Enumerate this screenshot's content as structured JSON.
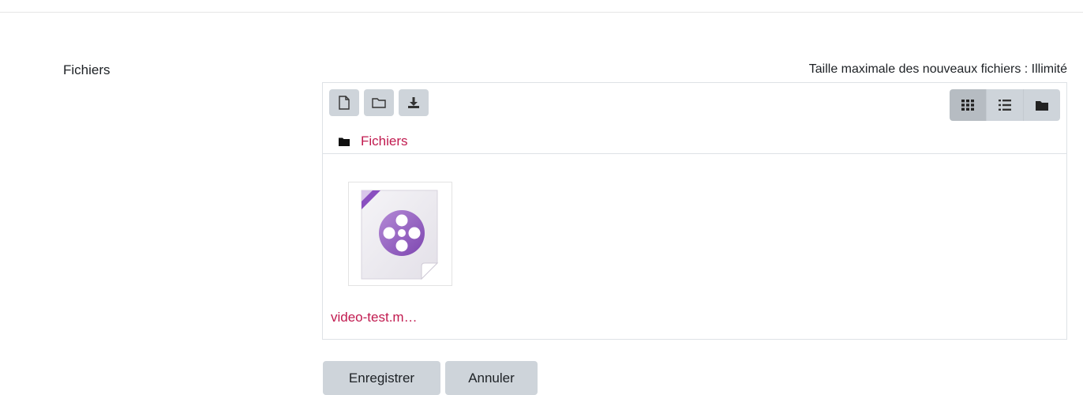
{
  "form": {
    "field_label": "Fichiers",
    "max_size_text": "Taille maximale des nouveaux fichiers : Illimité"
  },
  "filemanager": {
    "toolbar": [
      {
        "icon": "new-file-icon"
      },
      {
        "icon": "new-folder-icon"
      },
      {
        "icon": "download-icon"
      }
    ],
    "view_modes": [
      {
        "icon": "grid-view-icon",
        "active": true
      },
      {
        "icon": "list-view-icon",
        "active": false
      },
      {
        "icon": "tree-view-icon",
        "active": false
      }
    ],
    "path": {
      "icon": "folder-icon",
      "label": "Fichiers"
    },
    "files": [
      {
        "name": "video-test.m…",
        "icon": "video-file-icon"
      }
    ]
  },
  "actions": {
    "save_label": "Enregistrer",
    "cancel_label": "Annuler"
  },
  "colors": {
    "link": "#c11a4f",
    "button_bg": "#ced4da",
    "accent_purple": "#7b3fa8"
  }
}
